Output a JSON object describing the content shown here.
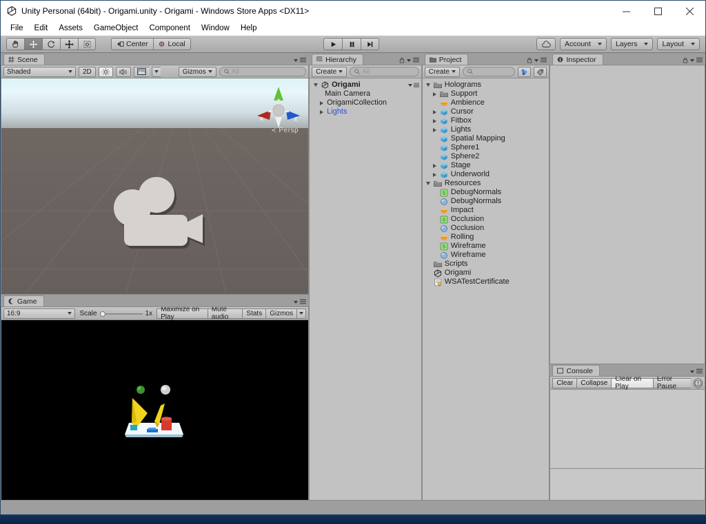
{
  "window": {
    "title": "Unity Personal (64bit) - Origami.unity - Origami - Windows Store Apps <DX11>",
    "app_icon": "unity-icon",
    "minimize": "—",
    "maximize": "□",
    "close": "✕"
  },
  "menu": {
    "items": [
      {
        "label": "File"
      },
      {
        "label": "Edit"
      },
      {
        "label": "Assets"
      },
      {
        "label": "GameObject"
      },
      {
        "label": "Component"
      },
      {
        "label": "Window"
      },
      {
        "label": "Help"
      }
    ]
  },
  "toolbar": {
    "tools": [
      {
        "name": "hand-tool",
        "glyph": "hand",
        "active": false
      },
      {
        "name": "move-tool",
        "glyph": "move",
        "active": true
      },
      {
        "name": "rotate-tool",
        "glyph": "rotate",
        "active": false
      },
      {
        "name": "scale-tool",
        "glyph": "scale",
        "active": false
      },
      {
        "name": "rect-tool",
        "glyph": "rect",
        "active": false
      }
    ],
    "pivot_label": "Center",
    "rotation_label": "Local",
    "play_label": "play-button",
    "pause_label": "pause-button",
    "step_label": "step-button",
    "cloud_label": "cloud-button",
    "account_label": "Account",
    "layers_label": "Layers",
    "layout_label": "Layout"
  },
  "scene": {
    "tab_label": "Scene",
    "shading_mode": "Shaded",
    "mode_2d": "2D",
    "gizmos_label": "Gizmos",
    "search_placeholder": "All",
    "perspective_label": "Persp",
    "axis_x": "x",
    "axis_y": "y",
    "axis_z": "z",
    "camera_gizmo": "main-camera-gizmo"
  },
  "game": {
    "tab_label": "Game",
    "aspect_ratio": "16:9",
    "scale_label": "Scale",
    "scale_value": "1x",
    "maximize_label": "Maximize on Play",
    "mute_label": "Mute audio",
    "stats_label": "Stats",
    "gizmos_label": "Gizmos"
  },
  "hierarchy": {
    "tab_label": "Hierarchy",
    "create_label": "Create",
    "search_placeholder": "All",
    "items": [
      {
        "label": "Origami",
        "icon": "unity-scene-icon",
        "depth": 0,
        "expanded": true,
        "arrow": "down",
        "bold": true,
        "prefab": false
      },
      {
        "label": "Main Camera",
        "icon": "none",
        "depth": 1,
        "arrow": "none",
        "bold": false,
        "prefab": false
      },
      {
        "label": "OrigamiCollection",
        "icon": "none",
        "depth": 1,
        "arrow": "right",
        "bold": false,
        "prefab": false
      },
      {
        "label": "Lights",
        "icon": "none",
        "depth": 1,
        "arrow": "right",
        "bold": false,
        "prefab": true
      }
    ]
  },
  "project": {
    "tab_label": "Project",
    "create_label": "Create",
    "search_placeholder": "",
    "items": [
      {
        "label": "Holograms",
        "icon": "folder-icon",
        "depth": 0,
        "arrow": "down"
      },
      {
        "label": "Support",
        "icon": "folder-icon",
        "depth": 1,
        "arrow": "right"
      },
      {
        "label": "Ambience",
        "icon": "audioclip-icon",
        "depth": 1,
        "arrow": "none"
      },
      {
        "label": "Cursor",
        "icon": "prefab-icon",
        "depth": 1,
        "arrow": "right"
      },
      {
        "label": "Fitbox",
        "icon": "prefab-icon",
        "depth": 1,
        "arrow": "right"
      },
      {
        "label": "Lights",
        "icon": "prefab-icon",
        "depth": 1,
        "arrow": "right"
      },
      {
        "label": "Spatial Mapping",
        "icon": "prefab-icon",
        "depth": 1,
        "arrow": "none"
      },
      {
        "label": "Sphere1",
        "icon": "prefab-icon",
        "depth": 1,
        "arrow": "none"
      },
      {
        "label": "Sphere2",
        "icon": "prefab-icon",
        "depth": 1,
        "arrow": "none"
      },
      {
        "label": "Stage",
        "icon": "prefab-icon",
        "depth": 1,
        "arrow": "right"
      },
      {
        "label": "Underworld",
        "icon": "prefab-icon",
        "depth": 1,
        "arrow": "right"
      },
      {
        "label": "Resources",
        "icon": "folder-icon",
        "depth": 0,
        "arrow": "down"
      },
      {
        "label": "DebugNormals",
        "icon": "shader-icon",
        "depth": 1,
        "arrow": "none"
      },
      {
        "label": "DebugNormals",
        "icon": "material-icon",
        "depth": 1,
        "arrow": "none"
      },
      {
        "label": "Impact",
        "icon": "audioclip-icon",
        "depth": 1,
        "arrow": "none"
      },
      {
        "label": "Occlusion",
        "icon": "shader-icon",
        "depth": 1,
        "arrow": "none"
      },
      {
        "label": "Occlusion",
        "icon": "material-icon",
        "depth": 1,
        "arrow": "none"
      },
      {
        "label": "Rolling",
        "icon": "audioclip-icon",
        "depth": 1,
        "arrow": "none"
      },
      {
        "label": "Wireframe",
        "icon": "shader-icon",
        "depth": 1,
        "arrow": "none"
      },
      {
        "label": "Wireframe",
        "icon": "material-icon",
        "depth": 1,
        "arrow": "none"
      },
      {
        "label": "Scripts",
        "icon": "folder-icon",
        "depth": 0,
        "arrow": "none"
      },
      {
        "label": "Origami",
        "icon": "unity-scene-icon",
        "depth": 0,
        "arrow": "none"
      },
      {
        "label": "WSATestCertificate",
        "icon": "certificate-icon",
        "depth": 0,
        "arrow": "none"
      }
    ]
  },
  "inspector": {
    "tab_label": "Inspector"
  },
  "console": {
    "tab_label": "Console",
    "clear_label": "Clear",
    "collapse_label": "Collapse",
    "clear_on_play_label": "Clear on Play",
    "error_pause_label": "Error Pause",
    "info_icon": "info-icon"
  },
  "colors": {
    "chrome": "#a0a0a0",
    "panel": "#c2c2c2",
    "prefab_blue": "#2a4fd8",
    "axis_x": "#b02a1e",
    "axis_y": "#4aa02c",
    "axis_z": "#1e4fb0",
    "game_bg": "#000000",
    "scene_ground": "#6b6360",
    "titlebar": "#ffffff"
  }
}
